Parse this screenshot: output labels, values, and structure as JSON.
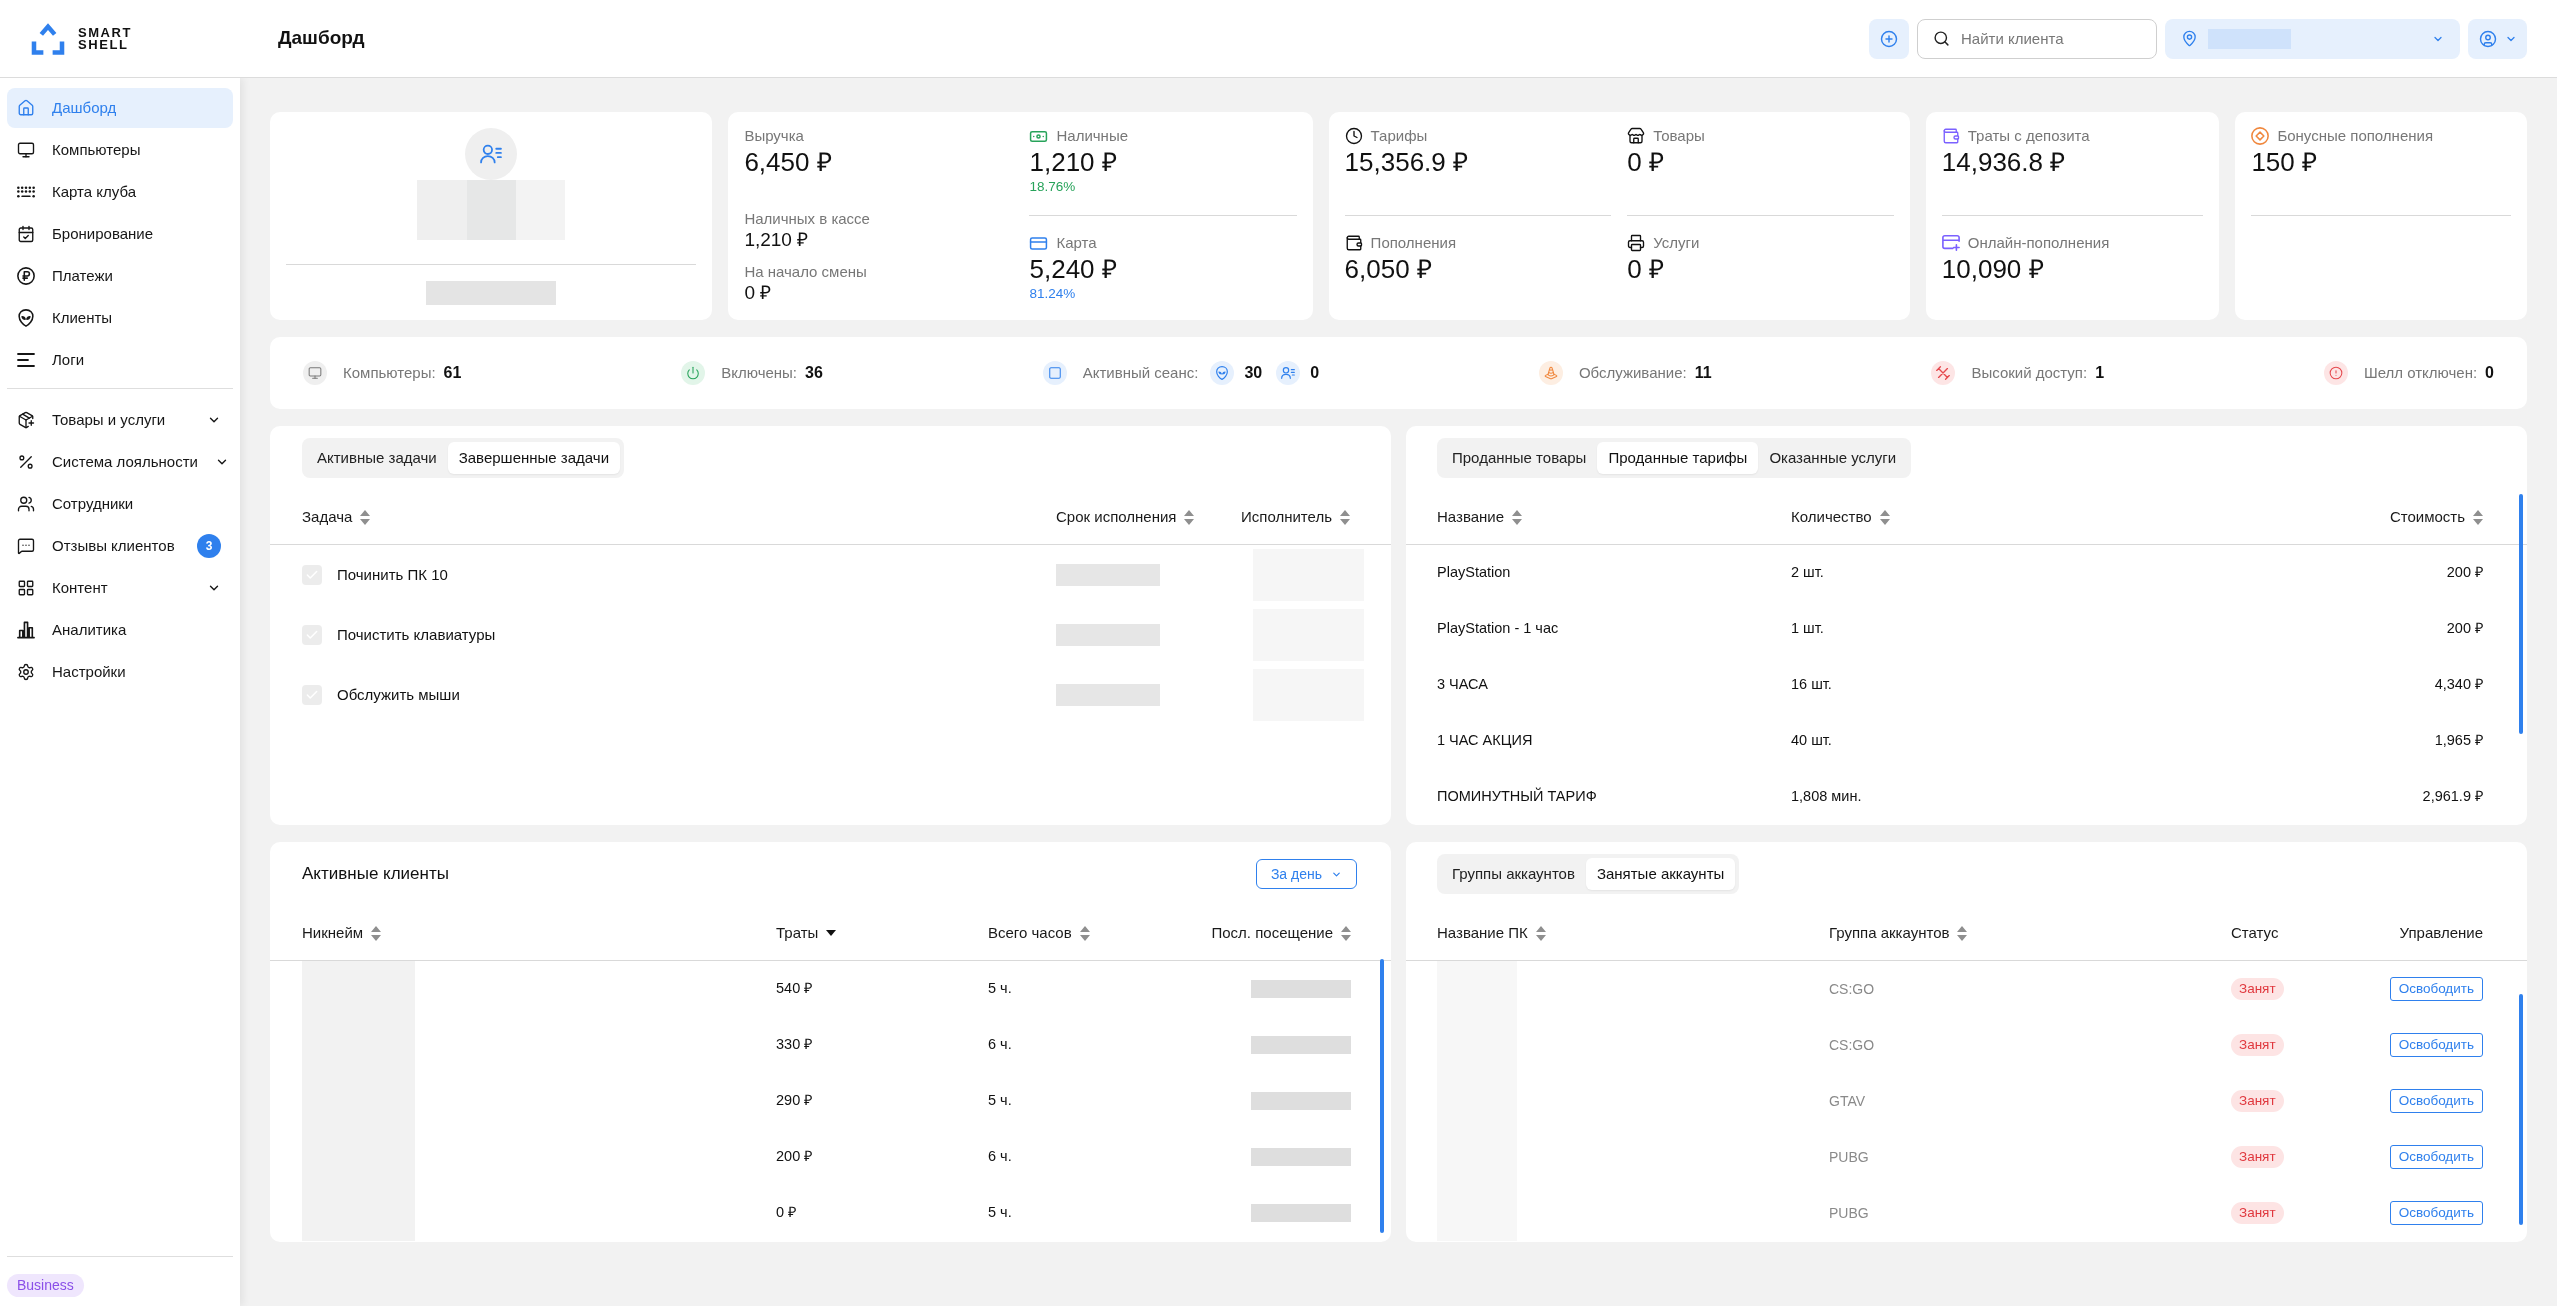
{
  "header": {
    "logo": [
      "SMART",
      "SHELL"
    ],
    "title": "Дашборд",
    "search": {
      "placeholder": "Найти клиента"
    }
  },
  "sidebar": {
    "groups": [
      [
        {
          "label": "Дашборд",
          "kind": "link",
          "selected": true
        },
        {
          "label": "Компьютеры",
          "kind": "link",
          "selected": false
        },
        {
          "label": "Карта клуба",
          "kind": "link",
          "selected": false
        },
        {
          "label": "Бронирование",
          "kind": "link",
          "selected": false
        },
        {
          "label": "Платежи",
          "kind": "link",
          "selected": false
        },
        {
          "label": "Клиенты",
          "kind": "link",
          "selected": false
        },
        {
          "label": "Логи",
          "kind": "link",
          "selected": false
        }
      ],
      [
        {
          "label": "Товары и услуги",
          "kind": "menu",
          "selected": false
        },
        {
          "label": "Система лояльности",
          "kind": "menu",
          "selected": false
        },
        {
          "label": "Сотрудники",
          "kind": "link",
          "selected": false
        },
        {
          "label": "Отзывы клиентов",
          "kind": "link",
          "selected": false,
          "badge": "3"
        },
        {
          "label": "Контент",
          "kind": "menu",
          "selected": false
        },
        {
          "label": "Аналитика",
          "kind": "link",
          "selected": false
        },
        {
          "label": "Настройки",
          "kind": "link",
          "selected": false
        }
      ]
    ],
    "plan": "Business"
  },
  "revenue_card": {
    "label": "Выручка",
    "value": "6,450 ₽",
    "details": [
      {
        "label": "Наличных в кассе",
        "value": "1,210 ₽"
      },
      {
        "label": "На начало смены",
        "value": "0 ₽"
      }
    ],
    "payments": [
      {
        "label": "Наличные",
        "value": "1,210 ₽",
        "share": "18.76%",
        "color": "#27a35a"
      },
      {
        "label": "Карта",
        "value": "5,240 ₽",
        "share": "81.24%",
        "color": "#2f80ed"
      }
    ]
  },
  "summary_cards": [
    {
      "metrics": [
        {
          "label": "Тарифы",
          "value": "15,356.9 ₽"
        },
        {
          "label": "Товары",
          "value": "0 ₽"
        },
        {
          "label": "Пополнения",
          "value": "6,050 ₽"
        },
        {
          "label": "Услуги",
          "value": "0 ₽"
        }
      ]
    },
    {
      "metrics": [
        {
          "label": "Траты с депозита",
          "value": "14,936.8 ₽"
        },
        {
          "label": "Онлайн-пополнения",
          "value": "10,090 ₽"
        }
      ]
    },
    {
      "metrics": [
        {
          "label": "Бонусные пополнения",
          "value": "150 ₽"
        }
      ]
    }
  ],
  "status_bar": [
    {
      "kind": "count",
      "label": "Компьютеры:",
      "value": "61"
    },
    {
      "kind": "count",
      "label": "Включены:",
      "value": "36"
    },
    {
      "kind": "split",
      "label": "Активный сеанс:",
      "values": [
        "30",
        "0"
      ]
    },
    {
      "kind": "count",
      "label": "Обслуживание:",
      "value": "11"
    },
    {
      "kind": "count",
      "label": "Высокий доступ:",
      "value": "1"
    },
    {
      "kind": "count",
      "label": "Шелл отключен:",
      "value": "0"
    }
  ],
  "tasks_panel": {
    "tabs": [
      {
        "label": "Активные задачи",
        "selected": false
      },
      {
        "label": "Завершенные задачи",
        "selected": true
      }
    ],
    "columns": [
      {
        "label": "Задача",
        "sortable": true,
        "sorted": false
      },
      {
        "label": "Срок исполнения",
        "sortable": true,
        "sorted": false
      },
      {
        "label": "Исполнитель",
        "sortable": true,
        "sorted": false
      }
    ],
    "rows": [
      {
        "task": "Починить ПК 10",
        "checked": true
      },
      {
        "task": "Почистить клавиатуры",
        "checked": true
      },
      {
        "task": "Обслужить мыши",
        "checked": true
      }
    ]
  },
  "sales_panel": {
    "tabs": [
      {
        "label": "Проданные товары",
        "selected": false
      },
      {
        "label": "Проданные тарифы",
        "selected": true
      },
      {
        "label": "Оказанные услуги",
        "selected": false
      }
    ],
    "columns": [
      {
        "label": "Название",
        "sortable": true,
        "sorted": false
      },
      {
        "label": "Количество",
        "sortable": true,
        "sorted": false
      },
      {
        "label": "Стоимость",
        "sortable": true,
        "sorted": false
      }
    ],
    "rows": [
      {
        "name": "PlayStation",
        "quantity": "2 шт.",
        "cost": "200 ₽"
      },
      {
        "name": "PlayStation - 1 час",
        "quantity": "1 шт.",
        "cost": "200 ₽"
      },
      {
        "name": "3 ЧАСА",
        "quantity": "16 шт.",
        "cost": "4,340 ₽"
      },
      {
        "name": "1 ЧАС АКЦИЯ",
        "quantity": "40 шт.",
        "cost": "1,965 ₽"
      },
      {
        "name": "ПОМИНУТНЫЙ ТАРИФ",
        "quantity": "1,808 мин.",
        "cost": "2,961.9 ₽"
      }
    ]
  },
  "clients_panel": {
    "title": "Активные клиенты",
    "period": "За день",
    "columns": [
      {
        "label": "Никнейм",
        "sortable": true,
        "sorted": false
      },
      {
        "label": "Траты",
        "sortable": true,
        "sorted": true
      },
      {
        "label": "Всего часов",
        "sortable": true,
        "sorted": false
      },
      {
        "label": "Посл. посещение",
        "sortable": true,
        "sorted": false
      }
    ],
    "rows": [
      {
        "spent": "540 ₽",
        "hours": "5 ч."
      },
      {
        "spent": "330 ₽",
        "hours": "6 ч."
      },
      {
        "spent": "290 ₽",
        "hours": "5 ч."
      },
      {
        "spent": "200 ₽",
        "hours": "6 ч."
      },
      {
        "spent": "0 ₽",
        "hours": "5 ч."
      }
    ]
  },
  "accounts_panel": {
    "tabs": [
      {
        "label": "Группы аккаунтов",
        "selected": false
      },
      {
        "label": "Занятые аккаунты",
        "selected": true
      }
    ],
    "columns": [
      {
        "label": "Название ПК",
        "sortable": true,
        "sorted": false
      },
      {
        "label": "Группа аккаунтов",
        "sortable": true,
        "sorted": false
      },
      {
        "label": "Статус",
        "sortable": false
      },
      {
        "label": "Управление",
        "sortable": false
      }
    ],
    "rows": [
      {
        "group": "CS:GO",
        "status": "Занят",
        "action": "Освободить"
      },
      {
        "group": "CS:GO",
        "status": "Занят",
        "action": "Освободить"
      },
      {
        "group": "GTAV",
        "status": "Занят",
        "action": "Освободить"
      },
      {
        "group": "PUBG",
        "status": "Занят",
        "action": "Освободить"
      },
      {
        "group": "PUBG",
        "status": "Занят",
        "action": "Освободить"
      }
    ]
  }
}
